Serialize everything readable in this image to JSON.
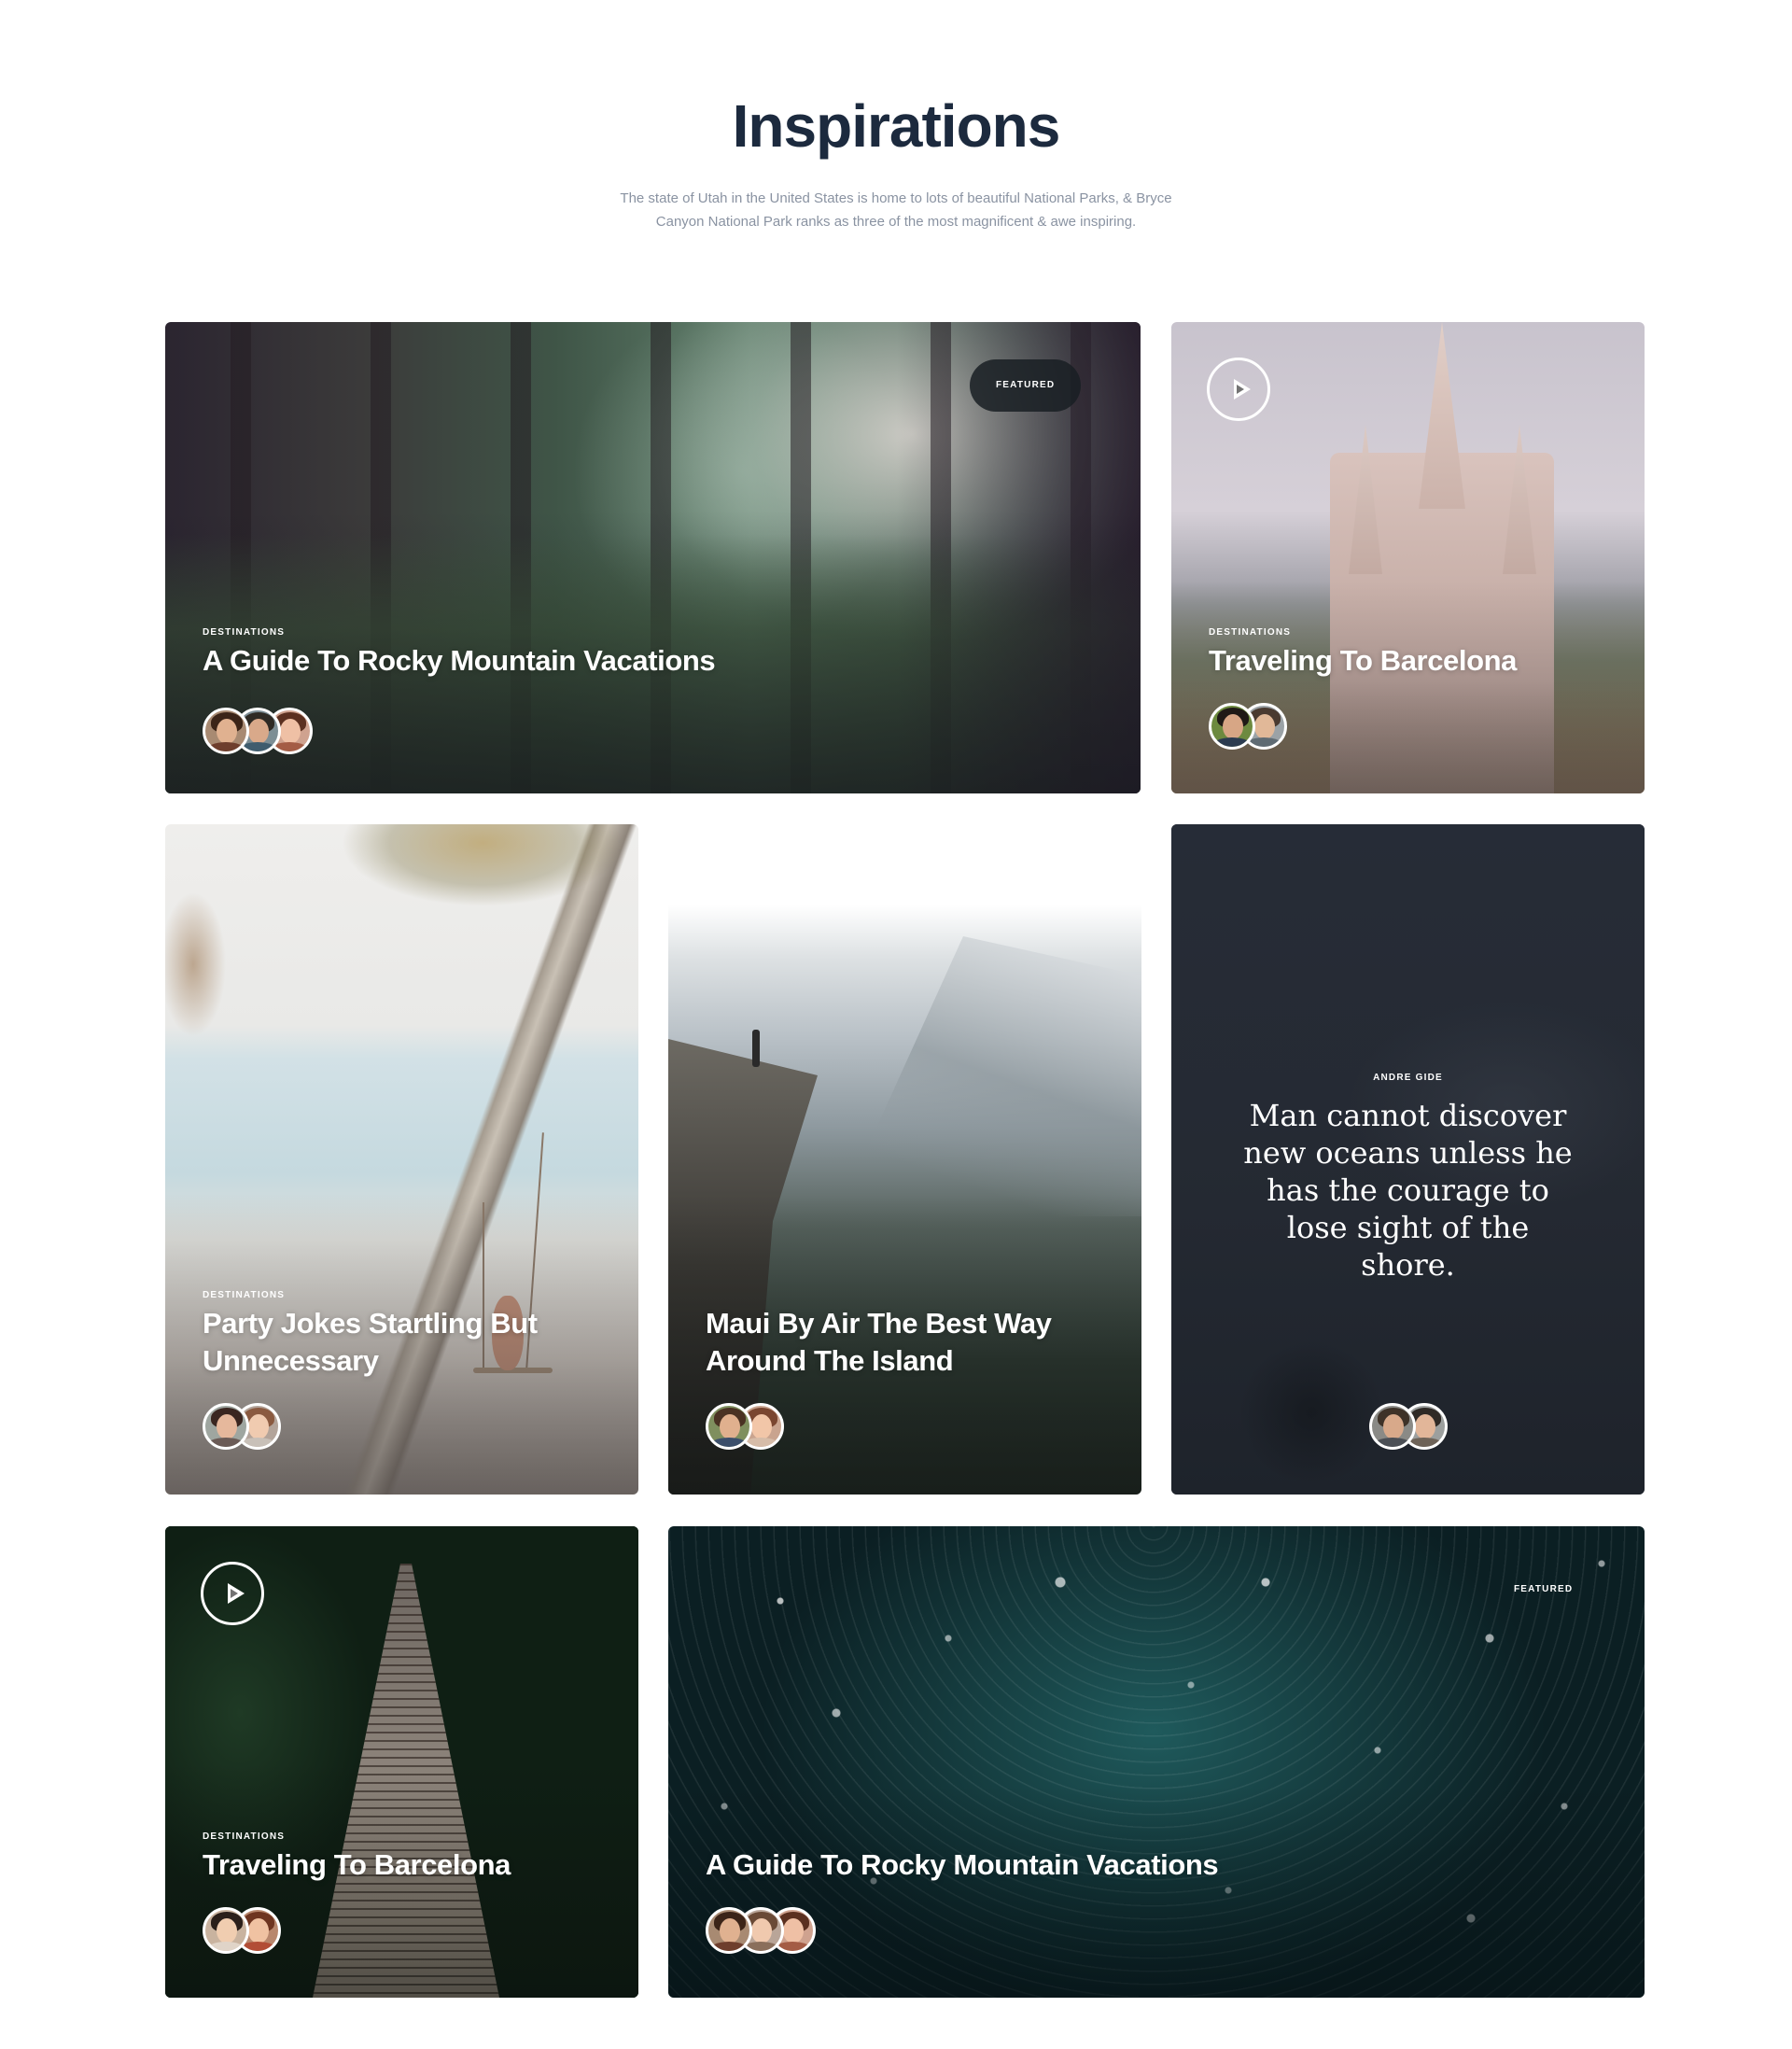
{
  "header": {
    "title": "Inspirations",
    "subtitle": "The state of Utah in the United States is home to lots of beautiful National Parks, & Bryce Canyon National Park ranks as three of the most magnificent & awe inspiring."
  },
  "cards": [
    {
      "category": "DESTINATIONS",
      "title": "A Guide To Rocky Mountain Vacations",
      "badge": "FEATURED",
      "avatars": [
        "author-1",
        "author-2",
        "author-3"
      ]
    },
    {
      "category": "DESTINATIONS",
      "title": "Traveling To Barcelona",
      "has_play": true,
      "avatars": [
        "author-1",
        "author-2"
      ]
    },
    {
      "category": "DESTINATIONS",
      "title": "Party Jokes Startling But Unnecessary",
      "avatars": [
        "author-1",
        "author-2"
      ]
    },
    {
      "category": "",
      "title": "Maui By Air The Best Way Around The Island",
      "avatars": [
        "author-1",
        "author-2"
      ]
    },
    {
      "type": "quote",
      "author": "ANDRE GIDE",
      "quote": "Man cannot discover new oceans unless he has the courage to lose sight of the shore.",
      "avatars": [
        "author-1",
        "author-2"
      ]
    },
    {
      "category": "DESTINATIONS",
      "title": "Traveling To Barcelona",
      "has_play": true,
      "avatars": [
        "author-1",
        "author-2"
      ]
    },
    {
      "category": "",
      "title": "A Guide To Rocky Mountain Vacations",
      "badge": "FEATURED",
      "avatars": [
        "author-1",
        "author-2",
        "author-3"
      ]
    }
  ],
  "colors": {
    "title": "#1c2a3e",
    "subtitle": "#8a93a2",
    "quote_card_bg": "#262c37"
  }
}
